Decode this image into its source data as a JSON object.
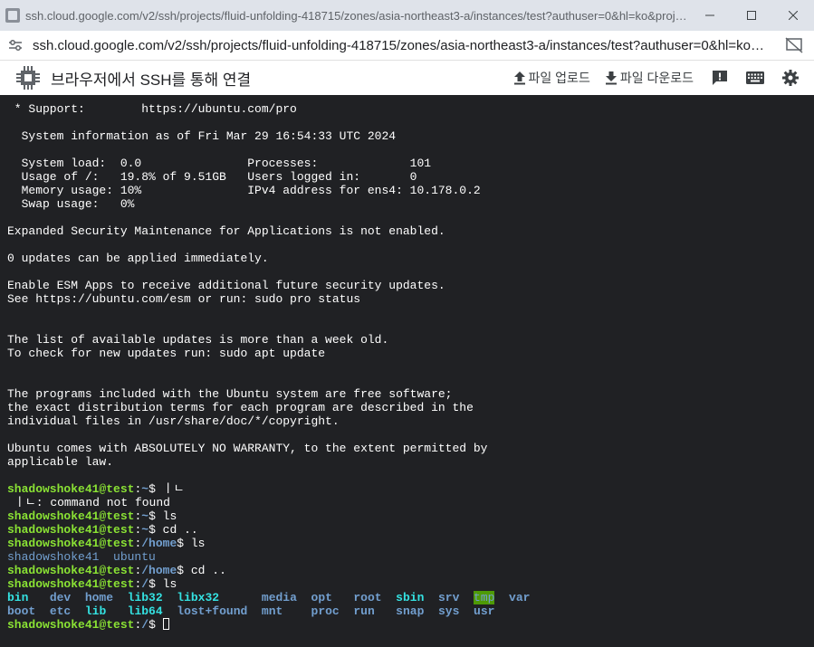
{
  "window": {
    "title": "ssh.cloud.google.com/v2/ssh/projects/fluid-unfolding-418715/zones/asia-northeast3-a/instances/test?authuser=0&hl=ko&projectNu...",
    "controls": [
      "minimize",
      "maximize",
      "close"
    ]
  },
  "addressbar": {
    "url": "ssh.cloud.google.com/v2/ssh/projects/fluid-unfolding-418715/zones/asia-northeast3-a/instances/test?authuser=0&hl=ko&proj..."
  },
  "header": {
    "title": "브라우저에서 SSH를 통해 연결",
    "upload_label": "파일 업로드",
    "download_label": "파일 다운로드"
  },
  "terminal": {
    "intro_lines": [
      " * Support:        https://ubuntu.com/pro",
      "",
      "  System information as of Fri Mar 29 16:54:33 UTC 2024",
      "",
      "  System load:  0.0               Processes:             101",
      "  Usage of /:   19.8% of 9.51GB   Users logged in:       0",
      "  Memory usage: 10%               IPv4 address for ens4: 10.178.0.2",
      "  Swap usage:   0%",
      "",
      "Expanded Security Maintenance for Applications is not enabled.",
      "",
      "0 updates can be applied immediately.",
      "",
      "Enable ESM Apps to receive additional future security updates.",
      "See https://ubuntu.com/esm or run: sudo pro status",
      "",
      "",
      "The list of available updates is more than a week old.",
      "To check for new updates run: sudo apt update",
      "",
      "",
      "The programs included with the Ubuntu system are free software;",
      "the exact distribution terms for each program are described in the",
      "individual files in /usr/share/doc/*/copyright.",
      "",
      "Ubuntu comes with ABSOLUTELY NO WARRANTY, to the extent permitted by",
      "applicable law.",
      ""
    ],
    "prompt_user": "shadowshoke41@test",
    "session": [
      {
        "path": "~",
        "cmd": " ㅣㄴ"
      },
      {
        "output": " ㅣㄴ: command not found"
      },
      {
        "path": "~",
        "cmd": " ls"
      },
      {
        "path": "~",
        "cmd": " cd .."
      },
      {
        "path": "/home",
        "cmd": " ls"
      },
      {
        "output_dirs": [
          "shadowshoke41",
          "ubuntu"
        ]
      },
      {
        "path": "/home",
        "cmd": " cd .."
      },
      {
        "path": "/",
        "cmd": " ls"
      }
    ],
    "root_listing": [
      [
        {
          "t": "bin",
          "c": "cyan"
        },
        {
          "t": "dev",
          "c": "dirb"
        },
        {
          "t": "home",
          "c": "dirb"
        },
        {
          "t": "lib32",
          "c": "cyan"
        },
        {
          "t": "libx32",
          "c": "cyan"
        },
        {
          "t": "media",
          "c": "dirb"
        },
        {
          "t": "opt",
          "c": "dirb"
        },
        {
          "t": "root",
          "c": "dirb"
        },
        {
          "t": "sbin",
          "c": "cyan"
        },
        {
          "t": "srv",
          "c": "dirb"
        },
        {
          "t": "tmp",
          "c": "tmp"
        },
        {
          "t": "var",
          "c": "dirb"
        }
      ],
      [
        {
          "t": "boot",
          "c": "dirb"
        },
        {
          "t": "etc",
          "c": "dirb"
        },
        {
          "t": "lib",
          "c": "cyan"
        },
        {
          "t": "lib64",
          "c": "cyan"
        },
        {
          "t": "lost+found",
          "c": "dirb"
        },
        {
          "t": "mnt",
          "c": "dirb"
        },
        {
          "t": "proc",
          "c": "dirb"
        },
        {
          "t": "run",
          "c": "dirb"
        },
        {
          "t": "snap",
          "c": "dirb"
        },
        {
          "t": "sys",
          "c": "dirb"
        },
        {
          "t": "usr",
          "c": "dirb"
        }
      ]
    ],
    "final_prompt_path": "/"
  }
}
